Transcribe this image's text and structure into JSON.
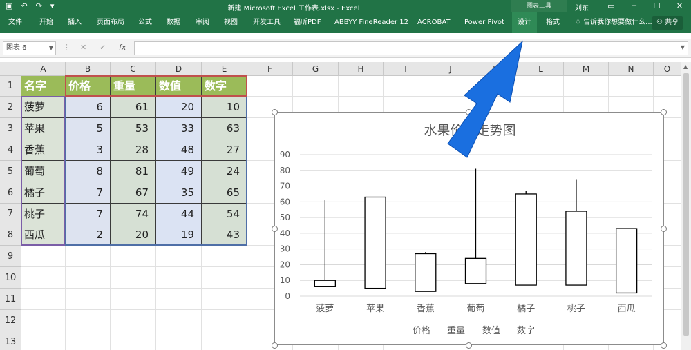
{
  "titlebar": {
    "undo": "↶",
    "redo": "↷",
    "title": "新建 Microsoft Excel 工作表.xlsx - Excel",
    "chart_tools": "图表工具",
    "user": "刘东",
    "minimize": "─",
    "restore": "☐",
    "close": "✕"
  },
  "ribbon": {
    "tabs": [
      "文件",
      "开始",
      "插入",
      "页面布局",
      "公式",
      "数据",
      "审阅",
      "视图",
      "开发工具",
      "福昕PDF",
      "ABBYY FineReader 12",
      "ACROBAT",
      "Power Pivot",
      "设计",
      "格式"
    ],
    "tell_me": "告诉我你想要做什么...",
    "share": "共享",
    "active_tab": "设计"
  },
  "formula_bar": {
    "name_box": "图表 6",
    "cancel": "✕",
    "enter": "✓",
    "fx": "fx",
    "value": ""
  },
  "sheet": {
    "columns": [
      "A",
      "B",
      "C",
      "D",
      "E",
      "F",
      "G",
      "H",
      "I",
      "J",
      "K",
      "L",
      "M",
      "N",
      "O"
    ],
    "rows": [
      "1",
      "2",
      "3",
      "4",
      "5",
      "6",
      "7",
      "8",
      "9",
      "10",
      "11",
      "12",
      "13"
    ],
    "headers": [
      "名字",
      "价格",
      "重量",
      "数值",
      "数字"
    ],
    "data": [
      [
        "菠萝",
        "6",
        "61",
        "20",
        "10"
      ],
      [
        "苹果",
        "5",
        "53",
        "33",
        "63"
      ],
      [
        "香蕉",
        "3",
        "28",
        "48",
        "27"
      ],
      [
        "葡萄",
        "8",
        "81",
        "49",
        "24"
      ],
      [
        "橘子",
        "7",
        "67",
        "35",
        "65"
      ],
      [
        "桃子",
        "7",
        "74",
        "44",
        "54"
      ],
      [
        "西瓜",
        "2",
        "20",
        "19",
        "43"
      ]
    ]
  },
  "chart_data": {
    "type": "stock",
    "title": "水果价格走势图",
    "categories": [
      "菠萝",
      "苹果",
      "香蕉",
      "葡萄",
      "橘子",
      "桃子",
      "西瓜"
    ],
    "series": [
      {
        "name": "价格",
        "values": [
          6,
          5,
          3,
          8,
          7,
          7,
          2
        ]
      },
      {
        "name": "重量",
        "values": [
          61,
          53,
          28,
          81,
          67,
          74,
          20
        ]
      },
      {
        "name": "数值",
        "values": [
          20,
          33,
          48,
          49,
          35,
          44,
          19
        ]
      },
      {
        "name": "数字",
        "values": [
          10,
          63,
          27,
          24,
          65,
          54,
          43
        ]
      }
    ],
    "ylim": [
      0,
      90
    ],
    "yticks": [
      0,
      10,
      20,
      30,
      40,
      50,
      60,
      70,
      80,
      90
    ],
    "grid": true,
    "legend": "bottom"
  },
  "colors": {
    "ribbon": "#217346",
    "header_fill": "#9bbb59",
    "arrow": "#1a6fe0"
  }
}
